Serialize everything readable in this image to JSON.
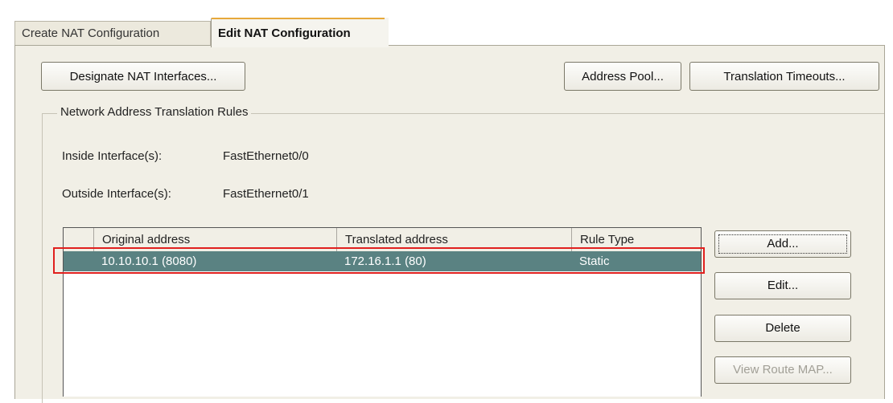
{
  "tabs": {
    "create": "Create NAT Configuration",
    "edit": "Edit NAT Configuration"
  },
  "toolbar": {
    "designate": "Designate NAT Interfaces...",
    "address_pool": "Address Pool...",
    "translation_timeouts": "Translation Timeouts..."
  },
  "group": {
    "title": "Network Address Translation Rules",
    "inside_label": "Inside Interface(s):",
    "inside_value": "FastEthernet0/0",
    "outside_label": "Outside Interface(s):",
    "outside_value": "FastEthernet0/1"
  },
  "table": {
    "columns": [
      "Original address",
      "Translated address",
      "Rule Type"
    ],
    "rows": [
      {
        "original": "10.10.10.1 (8080)",
        "translated": "172.16.1.1 (80)",
        "type": "Static"
      }
    ]
  },
  "actions": {
    "add": "Add...",
    "edit": "Edit...",
    "delete": "Delete",
    "view_route_map": "View Route MAP..."
  },
  "colors": {
    "selection": "#5a8282",
    "highlight_box": "#e0201e",
    "panel": "#f1efe6"
  }
}
